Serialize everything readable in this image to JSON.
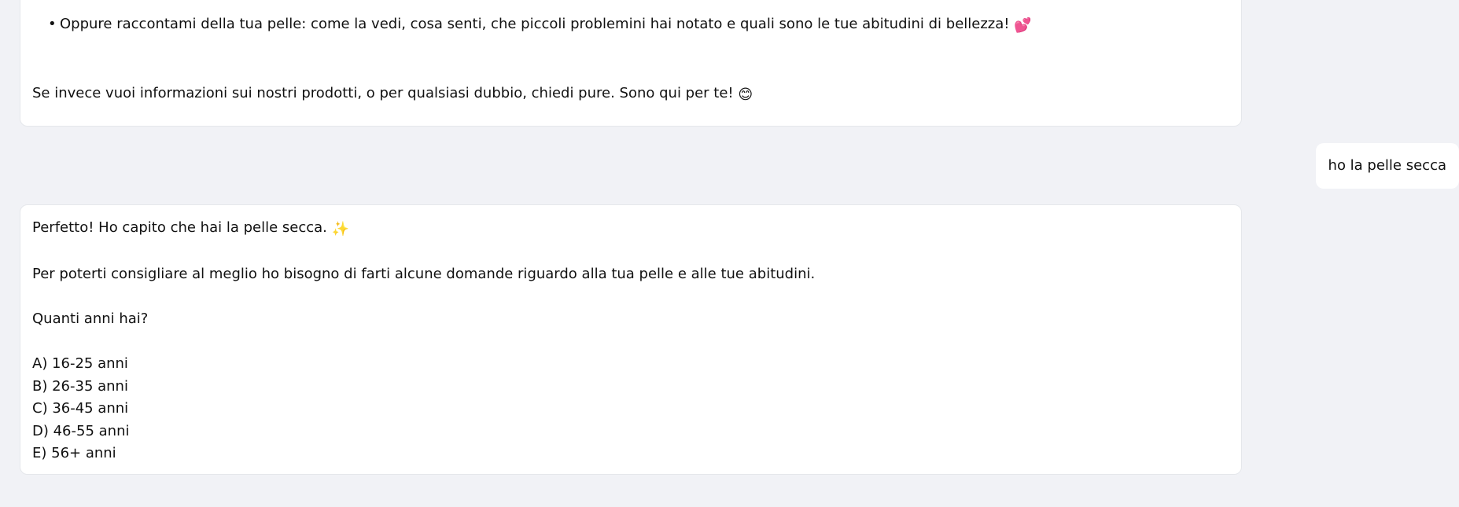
{
  "conversation": {
    "message_1": {
      "bullet_text": "Oppure raccontami della tua pelle: come la vedi, cosa senti, che piccoli problemini hai notato e quali sono le tue abitudini di bellezza!",
      "bullet_emoji": "💕",
      "closing_text": "Se invece vuoi informazioni sui nostri prodotti, o per qualsiasi dubbio, chiedi pure. Sono qui per te!",
      "closing_emoji": "😊"
    },
    "message_2": {
      "text": "ho la pelle secca"
    },
    "message_3": {
      "greeting_text": "Perfetto! Ho capito che hai la pelle secca.",
      "greeting_emoji": "✨",
      "intro": "Per poterti consigliare al meglio ho bisogno di farti alcune domande riguardo alla tua pelle e alle tue abitudini.",
      "question": "Quanti anni hai?",
      "options": [
        "A) 16-25 anni",
        "B) 26-35 anni",
        "C) 36-45 anni",
        "D) 46-55 anni",
        "E) 56+ anni"
      ]
    }
  }
}
